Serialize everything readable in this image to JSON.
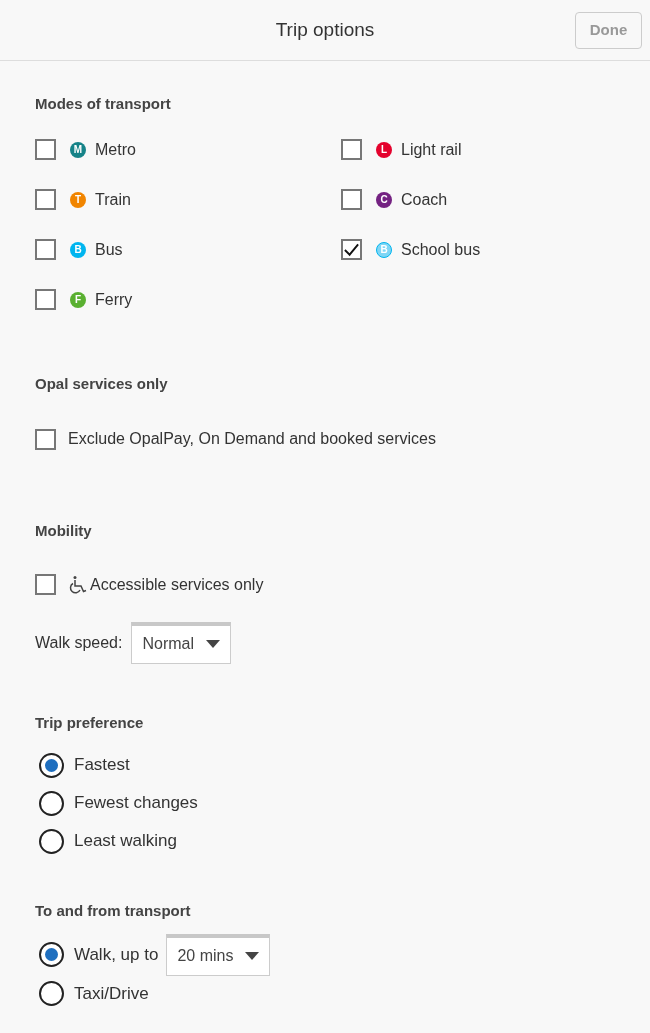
{
  "header": {
    "title": "Trip options",
    "done_button": {
      "label": "Done",
      "disabled": true
    }
  },
  "modes": {
    "heading": "Modes of transport",
    "items": [
      {
        "label": "Metro",
        "badge": "M",
        "color": "#168388",
        "kind": "solid",
        "checked": false
      },
      {
        "label": "Light rail",
        "badge": "L",
        "color": "#e4022d",
        "kind": "solid",
        "checked": false
      },
      {
        "label": "Train",
        "badge": "T",
        "color": "#f18500",
        "kind": "solid",
        "checked": false
      },
      {
        "label": "Coach",
        "badge": "C",
        "color": "#742282",
        "kind": "solid",
        "checked": false
      },
      {
        "label": "Bus",
        "badge": "B",
        "color": "#00b5ef",
        "kind": "solid",
        "checked": false
      },
      {
        "label": "School bus",
        "badge": "B",
        "color": "#00b5ef",
        "kind": "outline",
        "checked": true
      },
      {
        "label": "Ferry",
        "badge": "F",
        "color": "#5ab031",
        "kind": "solid",
        "checked": false
      }
    ]
  },
  "opal": {
    "heading": "Opal services only",
    "option": {
      "label": "Exclude OpalPay, On Demand and booked services",
      "checked": false
    }
  },
  "mobility": {
    "heading": "Mobility",
    "accessible": {
      "label": "Accessible services only",
      "checked": false
    },
    "walk_speed": {
      "label": "Walk speed:",
      "value": "Normal"
    }
  },
  "trip_preference": {
    "heading": "Trip preference",
    "options": [
      {
        "label": "Fastest",
        "selected": true
      },
      {
        "label": "Fewest changes",
        "selected": false
      },
      {
        "label": "Least walking",
        "selected": false
      }
    ]
  },
  "to_from": {
    "heading": "To and from transport",
    "options": [
      {
        "label": "Walk, up to",
        "selected": true,
        "kind": "walk",
        "select_value": "20 mins"
      },
      {
        "label": "Taxi/Drive",
        "selected": false,
        "kind": "plain"
      }
    ]
  }
}
